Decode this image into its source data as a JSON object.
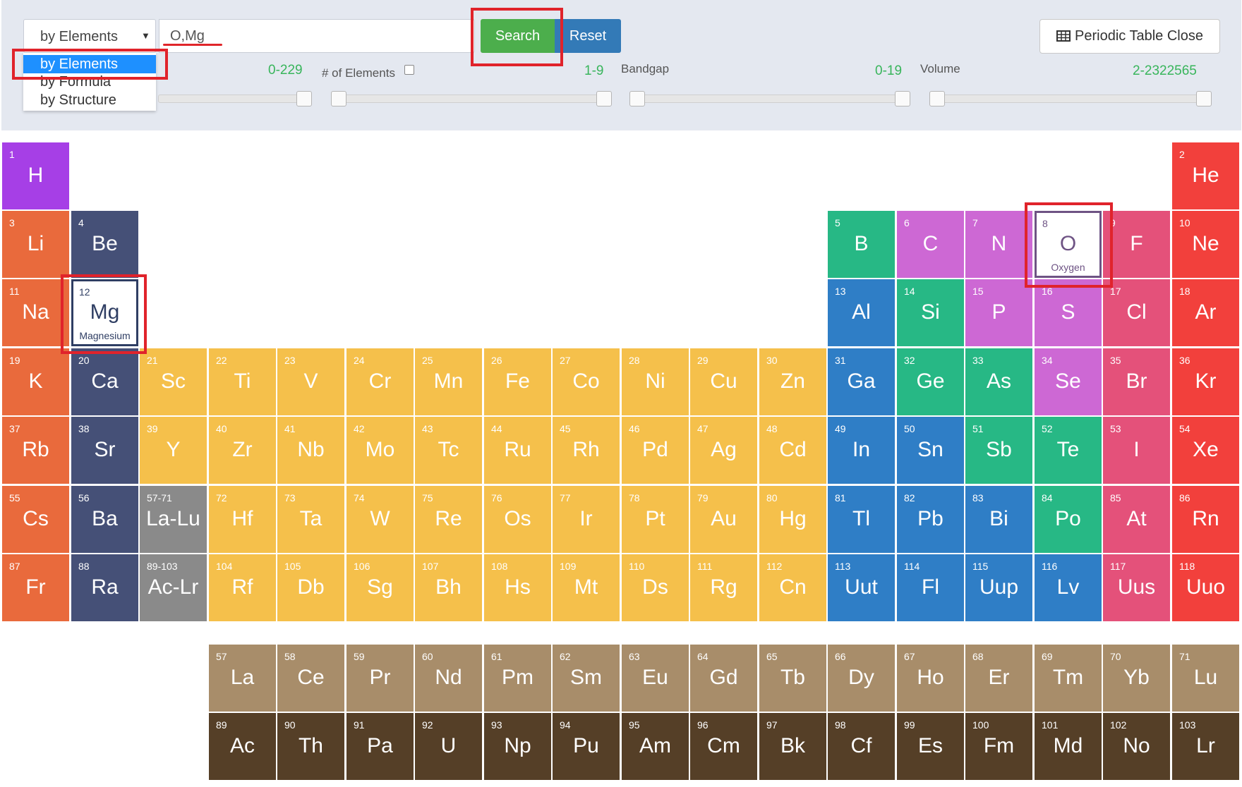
{
  "toolbar": {
    "search_type": "by Elements",
    "search_type_options": [
      "by Elements",
      "by Formula",
      "by Structure"
    ],
    "query_value": "O,Mg",
    "search_label": "Search",
    "reset_label": "Reset",
    "pt_close_label": "Periodic Table Close",
    "filters": [
      {
        "label": "",
        "range": "0-229"
      },
      {
        "label": "# of Elements",
        "range": "1-9"
      },
      {
        "label": "Bandgap",
        "range": "0-19"
      },
      {
        "label": "Volume",
        "range": "2-2322565"
      }
    ]
  },
  "colors": {
    "H": "#a63fe6",
    "alkali": "#e96a3c",
    "alkaline": "#455077",
    "transition": "#f5c04b",
    "lanthanide_marker": "#8a8a8a",
    "post_transition": "#2f7ec6",
    "metalloid": "#27b885",
    "nonmetal": "#cd68d4",
    "halogen": "#e4517a",
    "noble": "#f2403c",
    "lanthanide": "#a88d6a",
    "actinide": "#553f27",
    "selected": "#ffffff",
    "highlight": "#e0232b"
  },
  "elements": [
    {
      "n": "1",
      "s": "H",
      "c": "H"
    },
    {
      "n": "2",
      "s": "He",
      "c": "noble"
    },
    {
      "n": "3",
      "s": "Li",
      "c": "alkali"
    },
    {
      "n": "4",
      "s": "Be",
      "c": "alkaline"
    },
    {
      "n": "5",
      "s": "B",
      "c": "metalloid"
    },
    {
      "n": "6",
      "s": "C",
      "c": "nonmetal"
    },
    {
      "n": "7",
      "s": "N",
      "c": "nonmetal"
    },
    {
      "n": "8",
      "s": "O",
      "c": "nonmetal",
      "selected": true,
      "name": "Oxygen"
    },
    {
      "n": "9",
      "s": "F",
      "c": "halogen"
    },
    {
      "n": "10",
      "s": "Ne",
      "c": "noble"
    },
    {
      "n": "11",
      "s": "Na",
      "c": "alkali"
    },
    {
      "n": "12",
      "s": "Mg",
      "c": "alkaline",
      "selected": true,
      "name": "Magnesium"
    },
    {
      "n": "13",
      "s": "Al",
      "c": "post_transition"
    },
    {
      "n": "14",
      "s": "Si",
      "c": "metalloid"
    },
    {
      "n": "15",
      "s": "P",
      "c": "nonmetal"
    },
    {
      "n": "16",
      "s": "S",
      "c": "nonmetal"
    },
    {
      "n": "17",
      "s": "Cl",
      "c": "halogen"
    },
    {
      "n": "18",
      "s": "Ar",
      "c": "noble"
    },
    {
      "n": "19",
      "s": "K",
      "c": "alkali"
    },
    {
      "n": "20",
      "s": "Ca",
      "c": "alkaline"
    },
    {
      "n": "21",
      "s": "Sc",
      "c": "transition"
    },
    {
      "n": "22",
      "s": "Ti",
      "c": "transition"
    },
    {
      "n": "23",
      "s": "V",
      "c": "transition"
    },
    {
      "n": "24",
      "s": "Cr",
      "c": "transition"
    },
    {
      "n": "25",
      "s": "Mn",
      "c": "transition"
    },
    {
      "n": "26",
      "s": "Fe",
      "c": "transition"
    },
    {
      "n": "27",
      "s": "Co",
      "c": "transition"
    },
    {
      "n": "28",
      "s": "Ni",
      "c": "transition"
    },
    {
      "n": "29",
      "s": "Cu",
      "c": "transition"
    },
    {
      "n": "30",
      "s": "Zn",
      "c": "transition"
    },
    {
      "n": "31",
      "s": "Ga",
      "c": "post_transition"
    },
    {
      "n": "32",
      "s": "Ge",
      "c": "metalloid"
    },
    {
      "n": "33",
      "s": "As",
      "c": "metalloid"
    },
    {
      "n": "34",
      "s": "Se",
      "c": "nonmetal"
    },
    {
      "n": "35",
      "s": "Br",
      "c": "halogen"
    },
    {
      "n": "36",
      "s": "Kr",
      "c": "noble"
    },
    {
      "n": "37",
      "s": "Rb",
      "c": "alkali"
    },
    {
      "n": "38",
      "s": "Sr",
      "c": "alkaline"
    },
    {
      "n": "39",
      "s": "Y",
      "c": "transition"
    },
    {
      "n": "40",
      "s": "Zr",
      "c": "transition"
    },
    {
      "n": "41",
      "s": "Nb",
      "c": "transition"
    },
    {
      "n": "42",
      "s": "Mo",
      "c": "transition"
    },
    {
      "n": "43",
      "s": "Tc",
      "c": "transition"
    },
    {
      "n": "44",
      "s": "Ru",
      "c": "transition"
    },
    {
      "n": "45",
      "s": "Rh",
      "c": "transition"
    },
    {
      "n": "46",
      "s": "Pd",
      "c": "transition"
    },
    {
      "n": "47",
      "s": "Ag",
      "c": "transition"
    },
    {
      "n": "48",
      "s": "Cd",
      "c": "transition"
    },
    {
      "n": "49",
      "s": "In",
      "c": "post_transition"
    },
    {
      "n": "50",
      "s": "Sn",
      "c": "post_transition"
    },
    {
      "n": "51",
      "s": "Sb",
      "c": "metalloid"
    },
    {
      "n": "52",
      "s": "Te",
      "c": "metalloid"
    },
    {
      "n": "53",
      "s": "I",
      "c": "halogen"
    },
    {
      "n": "54",
      "s": "Xe",
      "c": "noble"
    },
    {
      "n": "55",
      "s": "Cs",
      "c": "alkali"
    },
    {
      "n": "56",
      "s": "Ba",
      "c": "alkaline"
    },
    {
      "n": "57-71",
      "s": "La-Lu",
      "c": "lanthanide_marker"
    },
    {
      "n": "72",
      "s": "Hf",
      "c": "transition"
    },
    {
      "n": "73",
      "s": "Ta",
      "c": "transition"
    },
    {
      "n": "74",
      "s": "W",
      "c": "transition"
    },
    {
      "n": "75",
      "s": "Re",
      "c": "transition"
    },
    {
      "n": "76",
      "s": "Os",
      "c": "transition"
    },
    {
      "n": "77",
      "s": "Ir",
      "c": "transition"
    },
    {
      "n": "78",
      "s": "Pt",
      "c": "transition"
    },
    {
      "n": "79",
      "s": "Au",
      "c": "transition"
    },
    {
      "n": "80",
      "s": "Hg",
      "c": "transition"
    },
    {
      "n": "81",
      "s": "Tl",
      "c": "post_transition"
    },
    {
      "n": "82",
      "s": "Pb",
      "c": "post_transition"
    },
    {
      "n": "83",
      "s": "Bi",
      "c": "post_transition"
    },
    {
      "n": "84",
      "s": "Po",
      "c": "metalloid"
    },
    {
      "n": "85",
      "s": "At",
      "c": "halogen"
    },
    {
      "n": "86",
      "s": "Rn",
      "c": "noble"
    },
    {
      "n": "87",
      "s": "Fr",
      "c": "alkali"
    },
    {
      "n": "88",
      "s": "Ra",
      "c": "alkaline"
    },
    {
      "n": "89-103",
      "s": "Ac-Lr",
      "c": "lanthanide_marker"
    },
    {
      "n": "104",
      "s": "Rf",
      "c": "transition"
    },
    {
      "n": "105",
      "s": "Db",
      "c": "transition"
    },
    {
      "n": "106",
      "s": "Sg",
      "c": "transition"
    },
    {
      "n": "107",
      "s": "Bh",
      "c": "transition"
    },
    {
      "n": "108",
      "s": "Hs",
      "c": "transition"
    },
    {
      "n": "109",
      "s": "Mt",
      "c": "transition"
    },
    {
      "n": "110",
      "s": "Ds",
      "c": "transition"
    },
    {
      "n": "111",
      "s": "Rg",
      "c": "transition"
    },
    {
      "n": "112",
      "s": "Cn",
      "c": "transition"
    },
    {
      "n": "113",
      "s": "Uut",
      "c": "post_transition"
    },
    {
      "n": "114",
      "s": "Fl",
      "c": "post_transition"
    },
    {
      "n": "115",
      "s": "Uup",
      "c": "post_transition"
    },
    {
      "n": "116",
      "s": "Lv",
      "c": "post_transition"
    },
    {
      "n": "117",
      "s": "Uus",
      "c": "halogen"
    },
    {
      "n": "118",
      "s": "Uuo",
      "c": "noble"
    },
    {
      "n": "57",
      "s": "La",
      "c": "lanthanide"
    },
    {
      "n": "58",
      "s": "Ce",
      "c": "lanthanide"
    },
    {
      "n": "59",
      "s": "Pr",
      "c": "lanthanide"
    },
    {
      "n": "60",
      "s": "Nd",
      "c": "lanthanide"
    },
    {
      "n": "61",
      "s": "Pm",
      "c": "lanthanide"
    },
    {
      "n": "62",
      "s": "Sm",
      "c": "lanthanide"
    },
    {
      "n": "63",
      "s": "Eu",
      "c": "lanthanide"
    },
    {
      "n": "64",
      "s": "Gd",
      "c": "lanthanide"
    },
    {
      "n": "65",
      "s": "Tb",
      "c": "lanthanide"
    },
    {
      "n": "66",
      "s": "Dy",
      "c": "lanthanide"
    },
    {
      "n": "67",
      "s": "Ho",
      "c": "lanthanide"
    },
    {
      "n": "68",
      "s": "Er",
      "c": "lanthanide"
    },
    {
      "n": "69",
      "s": "Tm",
      "c": "lanthanide"
    },
    {
      "n": "70",
      "s": "Yb",
      "c": "lanthanide"
    },
    {
      "n": "71",
      "s": "Lu",
      "c": "lanthanide"
    },
    {
      "n": "89",
      "s": "Ac",
      "c": "actinide"
    },
    {
      "n": "90",
      "s": "Th",
      "c": "actinide"
    },
    {
      "n": "91",
      "s": "Pa",
      "c": "actinide"
    },
    {
      "n": "92",
      "s": "U",
      "c": "actinide"
    },
    {
      "n": "93",
      "s": "Np",
      "c": "actinide"
    },
    {
      "n": "94",
      "s": "Pu",
      "c": "actinide"
    },
    {
      "n": "95",
      "s": "Am",
      "c": "actinide"
    },
    {
      "n": "96",
      "s": "Cm",
      "c": "actinide"
    },
    {
      "n": "97",
      "s": "Bk",
      "c": "actinide"
    },
    {
      "n": "98",
      "s": "Cf",
      "c": "actinide"
    },
    {
      "n": "99",
      "s": "Es",
      "c": "actinide"
    },
    {
      "n": "100",
      "s": "Fm",
      "c": "actinide"
    },
    {
      "n": "101",
      "s": "Md",
      "c": "actinide"
    },
    {
      "n": "102",
      "s": "No",
      "c": "actinide"
    },
    {
      "n": "103",
      "s": "Lr",
      "c": "actinide"
    }
  ]
}
